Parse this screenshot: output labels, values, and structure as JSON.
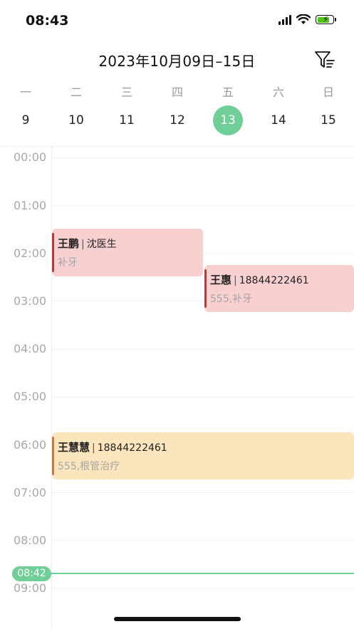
{
  "status_bar": {
    "time": "08:43"
  },
  "header": {
    "title": "2023年10月09日–15日"
  },
  "week": {
    "weekdays": [
      "一",
      "二",
      "三",
      "四",
      "五",
      "六",
      "日"
    ],
    "days": [
      "9",
      "10",
      "11",
      "12",
      "13",
      "14",
      "15"
    ],
    "selected_day": "13"
  },
  "timeline": {
    "hours": [
      "00:00",
      "01:00",
      "02:00",
      "03:00",
      "04:00",
      "05:00",
      "06:00",
      "07:00",
      "08:00",
      "09:00"
    ],
    "now_label": "08:42"
  },
  "events": [
    {
      "name": "王鹏",
      "detail": "沈医生",
      "sub": "补牙",
      "color": "pink"
    },
    {
      "name": "王惠",
      "detail": "18844222461",
      "sub": "555,补牙",
      "color": "pink"
    },
    {
      "name": "王慧慧",
      "detail": "18844222461",
      "sub": "555,根管治疗",
      "color": "yellow"
    }
  ],
  "colors": {
    "accent": "#6fcf97",
    "event_pink": "#f8d0d0",
    "event_yellow": "#fbe5bd"
  },
  "icons": {
    "filter": "filter-icon"
  }
}
